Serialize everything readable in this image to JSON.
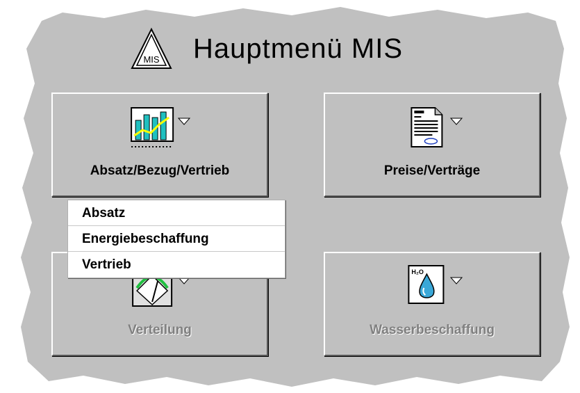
{
  "window": {
    "title": "Hauptmenü MIS"
  },
  "logo": {
    "text": "MIS",
    "icon": "mis-triangle-logo"
  },
  "tiles": [
    {
      "label": "Absatz/Bezug/Vertrieb",
      "icon": "bar-chart-icon",
      "enabled": true
    },
    {
      "label": "Preise/Verträge",
      "icon": "document-contract-icon",
      "enabled": true
    },
    {
      "label": "Verteilung",
      "icon": "gauge-icon",
      "enabled": false
    },
    {
      "label": "Wasserbeschaffung",
      "icon": "water-drop-icon",
      "enabled": false
    }
  ],
  "water_icon_text": "H₂O",
  "dropdown": {
    "items": [
      {
        "label": "Absatz"
      },
      {
        "label": "Energiebeschaffung"
      },
      {
        "label": "Vertrieb"
      }
    ]
  },
  "colors": {
    "panel": "#c0c0c0",
    "chart_bars": "#20c0c0",
    "chart_line": "#ffff00",
    "gauge_arc": "#20c040",
    "water_drop": "#3aa8d8"
  }
}
